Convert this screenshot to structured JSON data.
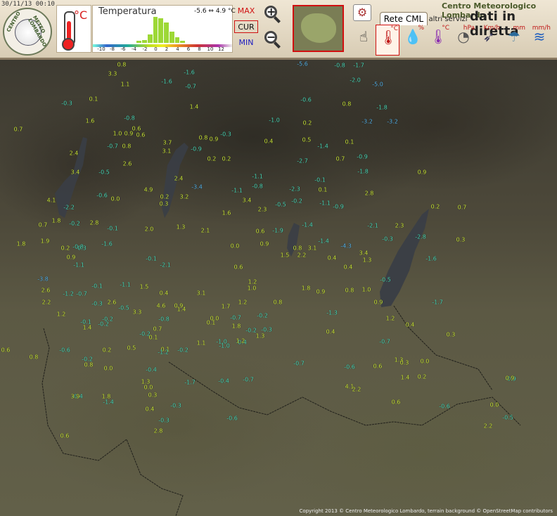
{
  "header": {
    "timestamp": "30/11/13 00:10",
    "logo_text_left": "CENTRO",
    "logo_text_right": "METEO LOMBARDO",
    "unit": "°C",
    "chart_title": "Temperatura",
    "range": "-5.6 ⇔ 4.9 °C",
    "max_label": "MAX",
    "cur_label": "CUR",
    "min_label": "MIN",
    "brand_line1": "Centro Meteorologico Lombardo",
    "brand_line2": "dati in diretta",
    "tab_active": "Rete CML",
    "tab_other": "altri servizi",
    "settings_icon": "⚙",
    "params": [
      {
        "name": "temperature",
        "symbol": "🌡",
        "sub": "°C"
      },
      {
        "name": "humidity",
        "symbol": "💧",
        "sub": "%"
      },
      {
        "name": "dewpoint",
        "symbol": "🌡",
        "sub": "°C"
      },
      {
        "name": "pressure",
        "symbol": "◔",
        "sub": "hPa"
      },
      {
        "name": "wind",
        "symbol": "➶",
        "sub": "Km/h"
      },
      {
        "name": "rain",
        "symbol": "☂",
        "sub": "mm"
      },
      {
        "name": "rain-rate",
        "symbol": "≋",
        "sub": "mm/h"
      }
    ]
  },
  "chart_data": {
    "type": "bar",
    "title": "Temperatura",
    "x_ticks": [
      "-10",
      "-8",
      "-6",
      "-4",
      "-2",
      "0",
      "2",
      "4",
      "6",
      "8",
      "10",
      "12"
    ],
    "categories": [
      "-3",
      "-2",
      "-1",
      "0",
      "1",
      "2",
      "3",
      "4",
      "5"
    ],
    "values": [
      2,
      3,
      9,
      28,
      26,
      22,
      12,
      6,
      2
    ],
    "ylim": [
      0,
      30
    ]
  },
  "map": {
    "copyright": "Copyright 2013 © Centro Meteorologico Lombardo, terrain background © OpenStreetMap contributors",
    "stations": [
      {
        "v": "0.8",
        "c": "y"
      },
      {
        "v": "3.3",
        "c": "y"
      },
      {
        "v": "-1.6",
        "c": "c"
      },
      {
        "v": "-5.6",
        "c": "b"
      },
      {
        "v": "-0.8",
        "c": "c"
      },
      {
        "v": "-1.7",
        "c": "c"
      },
      {
        "v": "1.1",
        "c": "y"
      },
      {
        "v": "-1.6",
        "c": "c"
      },
      {
        "v": "-0.7",
        "c": "c"
      },
      {
        "v": "-2.0",
        "c": "c"
      },
      {
        "v": "-5.0",
        "c": "b"
      },
      {
        "v": "-0.3",
        "c": "c"
      },
      {
        "v": "0.1",
        "c": "y"
      },
      {
        "v": "1.4",
        "c": "y"
      },
      {
        "v": "-0.6",
        "c": "c"
      },
      {
        "v": "0.8",
        "c": "y"
      },
      {
        "v": "-1.8",
        "c": "c"
      },
      {
        "v": "0.7",
        "c": "y"
      },
      {
        "v": "0.6",
        "c": "y"
      },
      {
        "v": "-0.8",
        "c": "c"
      },
      {
        "v": "1.6",
        "c": "y"
      },
      {
        "v": "-1.0",
        "c": "c"
      },
      {
        "v": "0.2",
        "c": "y"
      },
      {
        "v": "-3.2",
        "c": "b"
      },
      {
        "v": "-3.2",
        "c": "b"
      },
      {
        "v": "1.0",
        "c": "y"
      },
      {
        "v": "0.9",
        "c": "y"
      },
      {
        "v": "0.6",
        "c": "y"
      },
      {
        "v": "0.8",
        "c": "y"
      },
      {
        "v": "-0.3",
        "c": "c"
      },
      {
        "v": "0.4",
        "c": "y"
      },
      {
        "v": "0.5",
        "c": "y"
      },
      {
        "v": "0.1",
        "c": "y"
      },
      {
        "v": "-0.7",
        "c": "c"
      },
      {
        "v": "0.8",
        "c": "y"
      },
      {
        "v": "3.7",
        "c": "y"
      },
      {
        "v": "0.9",
        "c": "y"
      },
      {
        "v": "-1.4",
        "c": "c"
      },
      {
        "v": "-0.9",
        "c": "c"
      },
      {
        "v": "2.4",
        "c": "y"
      },
      {
        "v": "3.1",
        "c": "y"
      },
      {
        "v": "-0.9",
        "c": "c"
      },
      {
        "v": "0.2",
        "c": "y"
      },
      {
        "v": "0.2",
        "c": "y"
      },
      {
        "v": "-2.7",
        "c": "c"
      },
      {
        "v": "0.7",
        "c": "y"
      },
      {
        "v": "2.6",
        "c": "y"
      },
      {
        "v": "3.4",
        "c": "y"
      },
      {
        "v": "-0.5",
        "c": "c"
      },
      {
        "v": "2.4",
        "c": "y"
      },
      {
        "v": "-1.1",
        "c": "c"
      },
      {
        "v": "-0.1",
        "c": "c"
      },
      {
        "v": "-1.8",
        "c": "c"
      },
      {
        "v": "0.9",
        "c": "y"
      },
      {
        "v": "-3.4",
        "c": "b"
      },
      {
        "v": "4.9",
        "c": "y"
      },
      {
        "v": "-1.1",
        "c": "c"
      },
      {
        "v": "-0.8",
        "c": "c"
      },
      {
        "v": "-2.3",
        "c": "c"
      },
      {
        "v": "0.1",
        "c": "y"
      },
      {
        "v": "2.8",
        "c": "y"
      },
      {
        "v": "4.1",
        "c": "y"
      },
      {
        "v": "-0.6",
        "c": "c"
      },
      {
        "v": "0.0",
        "c": "y"
      },
      {
        "v": "0.2",
        "c": "y"
      },
      {
        "v": "3.2",
        "c": "y"
      },
      {
        "v": "3.4",
        "c": "y"
      },
      {
        "v": "-0.5",
        "c": "c"
      },
      {
        "v": "-0.2",
        "c": "c"
      },
      {
        "v": "-1.1",
        "c": "c"
      },
      {
        "v": "-2.2",
        "c": "c"
      },
      {
        "v": "0.3",
        "c": "y"
      },
      {
        "v": "2.3",
        "c": "y"
      },
      {
        "v": "-0.9",
        "c": "c"
      },
      {
        "v": "0.2",
        "c": "y"
      },
      {
        "v": "0.7",
        "c": "y"
      },
      {
        "v": "0.7",
        "c": "y"
      },
      {
        "v": "1.8",
        "c": "y"
      },
      {
        "v": "-0.2",
        "c": "c"
      },
      {
        "v": "2.8",
        "c": "y"
      },
      {
        "v": "1.6",
        "c": "y"
      },
      {
        "v": "-1.4",
        "c": "c"
      },
      {
        "v": "2.3",
        "c": "y"
      },
      {
        "v": "-2.1",
        "c": "c"
      },
      {
        "v": "-0.1",
        "c": "c"
      },
      {
        "v": "1.3",
        "c": "y"
      },
      {
        "v": "2.0",
        "c": "y"
      },
      {
        "v": "0.6",
        "c": "y"
      },
      {
        "v": "-1.9",
        "c": "c"
      },
      {
        "v": "-0.3",
        "c": "c"
      },
      {
        "v": "-2.8",
        "c": "c"
      },
      {
        "v": "0.3",
        "c": "y"
      },
      {
        "v": "1.8",
        "c": "y"
      },
      {
        "v": "1.9",
        "c": "y"
      },
      {
        "v": "0.2",
        "c": "y"
      },
      {
        "v": "-0.8",
        "c": "c"
      },
      {
        "v": "2.1",
        "c": "y"
      },
      {
        "v": "0.9",
        "c": "y"
      },
      {
        "v": "0.0",
        "c": "y"
      },
      {
        "v": "-1.4",
        "c": "c"
      },
      {
        "v": "-4.3",
        "c": "b"
      },
      {
        "v": "0.9",
        "c": "y"
      },
      {
        "v": "-0.3",
        "c": "c"
      },
      {
        "v": "-1.6",
        "c": "c"
      },
      {
        "v": "-0.1",
        "c": "c"
      },
      {
        "v": "0.8",
        "c": "y"
      },
      {
        "v": "3.1",
        "c": "y"
      },
      {
        "v": "3.4",
        "c": "y"
      },
      {
        "v": "-1.1",
        "c": "c"
      },
      {
        "v": "-2.1",
        "c": "c"
      },
      {
        "v": "0.6",
        "c": "y"
      },
      {
        "v": "1.5",
        "c": "y"
      },
      {
        "v": "2.2",
        "c": "y"
      },
      {
        "v": "0.4",
        "c": "y"
      },
      {
        "v": "0.4",
        "c": "y"
      },
      {
        "v": "1.3",
        "c": "y"
      },
      {
        "v": "-1.6",
        "c": "c"
      },
      {
        "v": "-3.8",
        "c": "b"
      },
      {
        "v": "-0.1",
        "c": "c"
      },
      {
        "v": "-1.1",
        "c": "c"
      },
      {
        "v": "1.5",
        "c": "y"
      },
      {
        "v": "1.2",
        "c": "y"
      },
      {
        "v": "-0.5",
        "c": "c"
      },
      {
        "v": "2.6",
        "c": "y"
      },
      {
        "v": "-1.2",
        "c": "c"
      },
      {
        "v": "-0.7",
        "c": "c"
      },
      {
        "v": "0.4",
        "c": "y"
      },
      {
        "v": "3.1",
        "c": "y"
      },
      {
        "v": "1.0",
        "c": "y"
      },
      {
        "v": "1.8",
        "c": "y"
      },
      {
        "v": "0.8",
        "c": "y"
      },
      {
        "v": "1.0",
        "c": "y"
      },
      {
        "v": "2.2",
        "c": "y"
      },
      {
        "v": "-0.3",
        "c": "c"
      },
      {
        "v": "2.6",
        "c": "y"
      },
      {
        "v": "4.6",
        "c": "y"
      },
      {
        "v": "0.9",
        "c": "y"
      },
      {
        "v": "1.2",
        "c": "y"
      },
      {
        "v": "0.8",
        "c": "y"
      },
      {
        "v": "0.9",
        "c": "y"
      },
      {
        "v": "1.2",
        "c": "y"
      },
      {
        "v": "-0.2",
        "c": "c"
      },
      {
        "v": "-0.5",
        "c": "c"
      },
      {
        "v": "3.3",
        "c": "y"
      },
      {
        "v": "1.4",
        "c": "y"
      },
      {
        "v": "1.7",
        "c": "y"
      },
      {
        "v": "-0.2",
        "c": "c"
      },
      {
        "v": "0.9",
        "c": "y"
      },
      {
        "v": "-0.1",
        "c": "c"
      },
      {
        "v": "-0.2",
        "c": "c"
      },
      {
        "v": "-0.8",
        "c": "c"
      },
      {
        "v": "0.0",
        "c": "y"
      },
      {
        "v": "-0.7",
        "c": "c"
      },
      {
        "v": "-1.3",
        "c": "c"
      },
      {
        "v": "-1.7",
        "c": "c"
      },
      {
        "v": "1.4",
        "c": "y"
      },
      {
        "v": "0.7",
        "c": "y"
      },
      {
        "v": "0.1",
        "c": "y"
      },
      {
        "v": "1.8",
        "c": "y"
      },
      {
        "v": "-0.2",
        "c": "c"
      },
      {
        "v": "-0.3",
        "c": "c"
      },
      {
        "v": "1.2",
        "c": "y"
      },
      {
        "v": "0.4",
        "c": "y"
      },
      {
        "v": "-0.2",
        "c": "c"
      },
      {
        "v": "0.1",
        "c": "y"
      },
      {
        "v": "1.1",
        "c": "y"
      },
      {
        "v": "-1.0",
        "c": "c"
      },
      {
        "v": "-0.4",
        "c": "c"
      },
      {
        "v": "1.3",
        "c": "y"
      },
      {
        "v": "0.4",
        "c": "y"
      },
      {
        "v": "0.3",
        "c": "y"
      },
      {
        "v": "-0.6",
        "c": "c"
      },
      {
        "v": "0.2",
        "c": "y"
      },
      {
        "v": "0.5",
        "c": "y"
      },
      {
        "v": "0.1",
        "c": "y"
      },
      {
        "v": "-1.0",
        "c": "c"
      },
      {
        "v": "1.2",
        "c": "y"
      },
      {
        "v": "-0.7",
        "c": "c"
      },
      {
        "v": "0.6",
        "c": "y"
      },
      {
        "v": "-0.2",
        "c": "c"
      },
      {
        "v": "-1.2",
        "c": "c"
      },
      {
        "v": "-0.2",
        "c": "c"
      },
      {
        "v": "-0.7",
        "c": "c"
      },
      {
        "v": "-0.6",
        "c": "c"
      },
      {
        "v": "0.6",
        "c": "y"
      },
      {
        "v": "1.3",
        "c": "y"
      },
      {
        "v": "0.8",
        "c": "y"
      },
      {
        "v": "0.0",
        "c": "y"
      },
      {
        "v": "-0.4",
        "c": "c"
      },
      {
        "v": "-1.7",
        "c": "c"
      },
      {
        "v": "0.3",
        "c": "y"
      },
      {
        "v": "1.4",
        "c": "y"
      },
      {
        "v": "0.2",
        "c": "y"
      },
      {
        "v": "0.0",
        "c": "y"
      },
      {
        "v": "0.8",
        "c": "y"
      },
      {
        "v": "1.3",
        "c": "y"
      },
      {
        "v": "0.0",
        "c": "y"
      },
      {
        "v": "-0.4",
        "c": "c"
      },
      {
        "v": "-0.7",
        "c": "c"
      },
      {
        "v": "4.1",
        "c": "y"
      },
      {
        "v": "-0.9",
        "c": "c"
      },
      {
        "v": "0.9",
        "c": "y"
      },
      {
        "v": "-0.4",
        "c": "c"
      },
      {
        "v": "-1.4",
        "c": "c"
      },
      {
        "v": "0.3",
        "c": "y"
      },
      {
        "v": "-0.3",
        "c": "c"
      },
      {
        "v": "2.2",
        "c": "y"
      },
      {
        "v": "0.6",
        "c": "y"
      },
      {
        "v": "-0.6",
        "c": "c"
      },
      {
        "v": "0.0",
        "c": "y"
      },
      {
        "v": "3.9",
        "c": "y"
      },
      {
        "v": "1.8",
        "c": "y"
      },
      {
        "v": "0.4",
        "c": "y"
      },
      {
        "v": "-0.3",
        "c": "c"
      },
      {
        "v": "-0.6",
        "c": "c"
      },
      {
        "v": "2.2",
        "c": "y"
      },
      {
        "v": "-0.5",
        "c": "c"
      },
      {
        "v": "0.6",
        "c": "y"
      },
      {
        "v": "2.8",
        "c": "y"
      }
    ]
  }
}
